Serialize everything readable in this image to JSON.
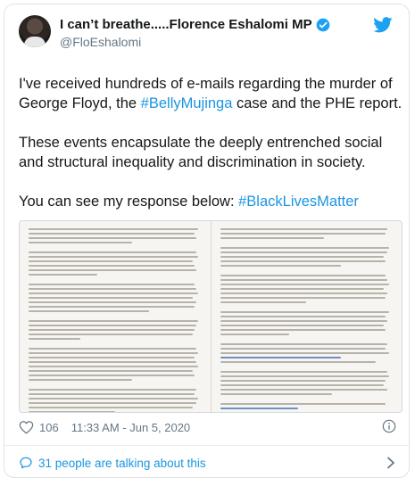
{
  "tweet": {
    "author_name": "I can’t breathe.....Florence Eshalomi MP",
    "handle": "@FloEshalomi",
    "paragraph1_pre": "I've received hundreds of e-mails regarding the murder of George Floyd, the ",
    "hashtag1": "#BellyMujinga",
    "paragraph1_post": " case and the PHE report.",
    "paragraph2": "These events encapsulate the deeply entrenched social and structural inequality and discrimination in society.",
    "paragraph3_pre": "You can see my response below: ",
    "hashtag2": "#BlackLivesMatter",
    "likes": "106",
    "time": "11:33 AM - Jun 5, 2020",
    "replies_text": "31 people are talking about this"
  },
  "icons": {
    "verified": "verified-badge-icon",
    "platform": "bird-logo-icon",
    "like": "heart-icon",
    "info": "info-icon",
    "reply": "speech-bubble-icon",
    "chevron": "chevron-right-icon"
  },
  "colors": {
    "link": "#1b95e0",
    "text": "#14171a",
    "muted": "#657786",
    "border": "#dfe3e7"
  }
}
